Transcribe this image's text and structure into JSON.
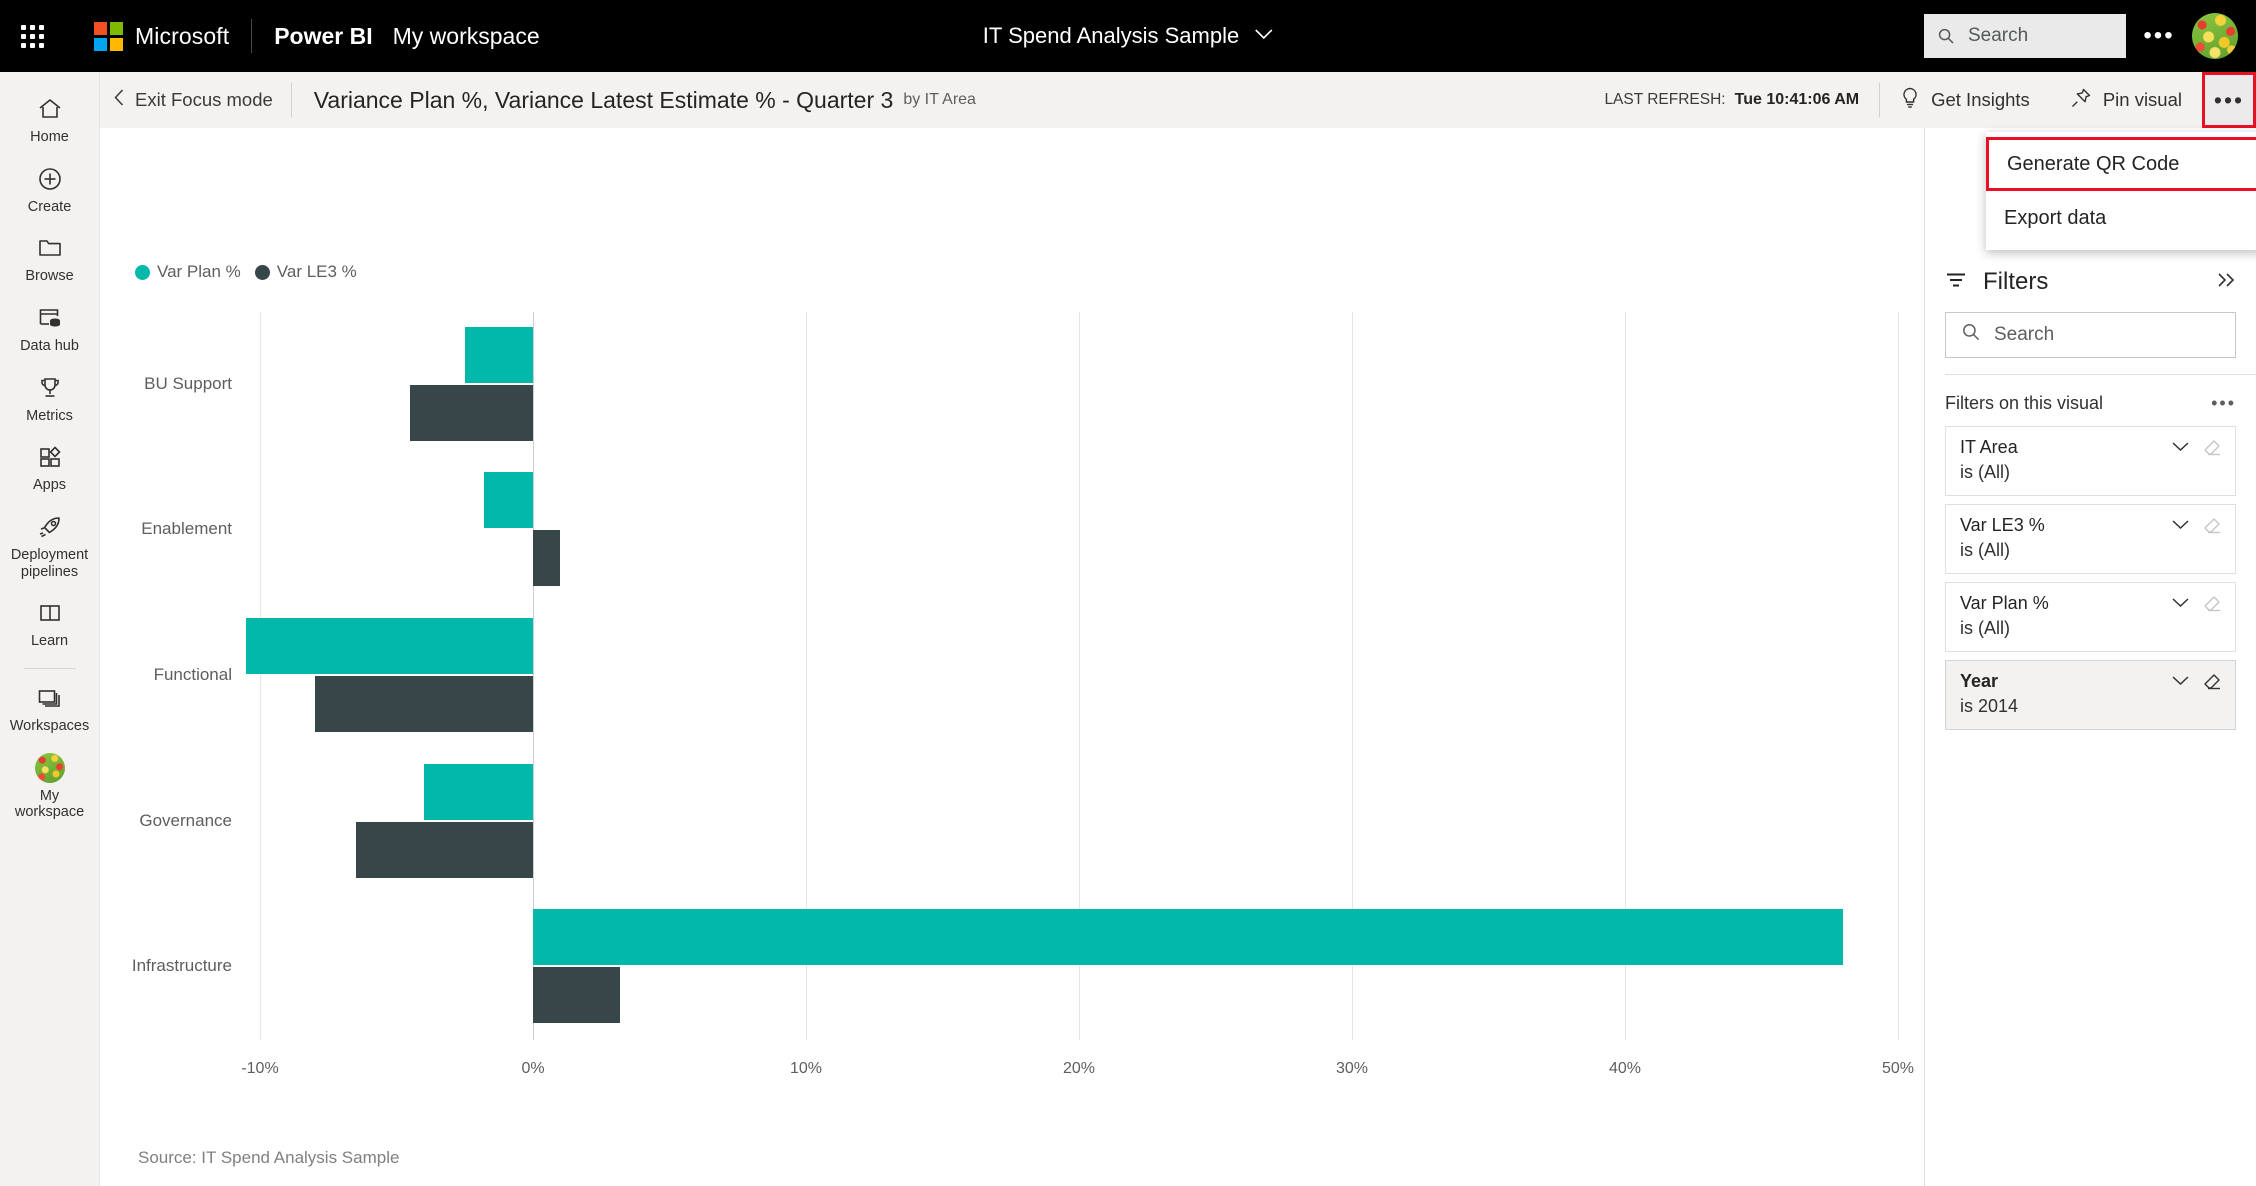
{
  "header": {
    "waffle_icon": "app-launcher-icon",
    "brand": "Microsoft",
    "product": "Power BI",
    "workspace": "My workspace",
    "report_title": "IT Spend Analysis Sample",
    "report_chevron": "chevron-down-icon",
    "search_placeholder": "Search",
    "search_icon": "search-icon",
    "more_label": "•••",
    "avatar_name": "user-avatar"
  },
  "sidebar": {
    "items": [
      {
        "label": "Home",
        "icon": "home-icon"
      },
      {
        "label": "Create",
        "icon": "plus-circle-icon"
      },
      {
        "label": "Browse",
        "icon": "folder-icon"
      },
      {
        "label": "Data hub",
        "icon": "data-hub-icon"
      },
      {
        "label": "Metrics",
        "icon": "trophy-icon"
      },
      {
        "label": "Apps",
        "icon": "apps-icon"
      },
      {
        "label": "Deployment pipelines",
        "icon": "rocket-icon"
      },
      {
        "label": "Learn",
        "icon": "book-icon"
      },
      {
        "label": "Workspaces",
        "icon": "workspaces-icon"
      },
      {
        "label": "My workspace",
        "icon": "workspace-avatar-icon"
      }
    ]
  },
  "command_bar": {
    "back_icon": "chevron-left-icon",
    "exit_focus_label": "Exit Focus mode",
    "visual_title": "Variance Plan %, Variance Latest Estimate % - Quarter 3",
    "visual_by": "by IT Area",
    "last_refresh_label": "LAST REFRESH:",
    "last_refresh_value": "Tue 10:41:06 AM",
    "get_insights_label": "Get Insights",
    "get_insights_icon": "lightbulb-icon",
    "pin_visual_label": "Pin visual",
    "pin_visual_icon": "pin-icon",
    "more_options_label": "•••",
    "more_options_highlight_color": "#e81123"
  },
  "menu": {
    "items": [
      {
        "label": "Generate QR Code",
        "highlighted": true
      },
      {
        "label": "Export data",
        "highlighted": false
      }
    ],
    "highlight_color": "#e81123"
  },
  "chart_data": {
    "type": "bar",
    "orientation": "horizontal",
    "title": "Variance Plan %, Variance Latest Estimate % - Quarter 3",
    "xlabel": "",
    "ylabel": "",
    "categories": [
      "BU Support",
      "Enablement",
      "Functional",
      "Governance",
      "Infrastructure"
    ],
    "series": [
      {
        "name": "Var Plan %",
        "color": "#01B8AA",
        "values": [
          -2.5,
          -1.8,
          -10.5,
          -4.0,
          48.0
        ]
      },
      {
        "name": "Var LE3 %",
        "color": "#374649",
        "values": [
          -4.5,
          1.0,
          -8.0,
          -6.5,
          3.2
        ]
      }
    ],
    "xlim": [
      -10,
      50
    ],
    "xticks": [
      -10,
      0,
      10,
      20,
      30,
      40,
      50
    ],
    "xticklabels": [
      "-10%",
      "0%",
      "10%",
      "20%",
      "30%",
      "40%",
      "50%"
    ],
    "grid": true,
    "legend_position": "top-left",
    "source_note": "Source: IT Spend Analysis Sample"
  },
  "filters": {
    "title": "Filters",
    "filter_icon": "filter-icon",
    "expand_icon": "double-chevron-right-icon",
    "search_placeholder": "Search",
    "search_icon": "search-icon",
    "section_label": "Filters on this visual",
    "section_more": "•••",
    "cards": [
      {
        "name": "IT Area",
        "value": "is (All)",
        "active": false
      },
      {
        "name": "Var LE3 %",
        "value": "is (All)",
        "active": false
      },
      {
        "name": "Var Plan %",
        "value": "is (All)",
        "active": false
      },
      {
        "name": "Year",
        "value": "is 2014",
        "active": true
      }
    ]
  }
}
